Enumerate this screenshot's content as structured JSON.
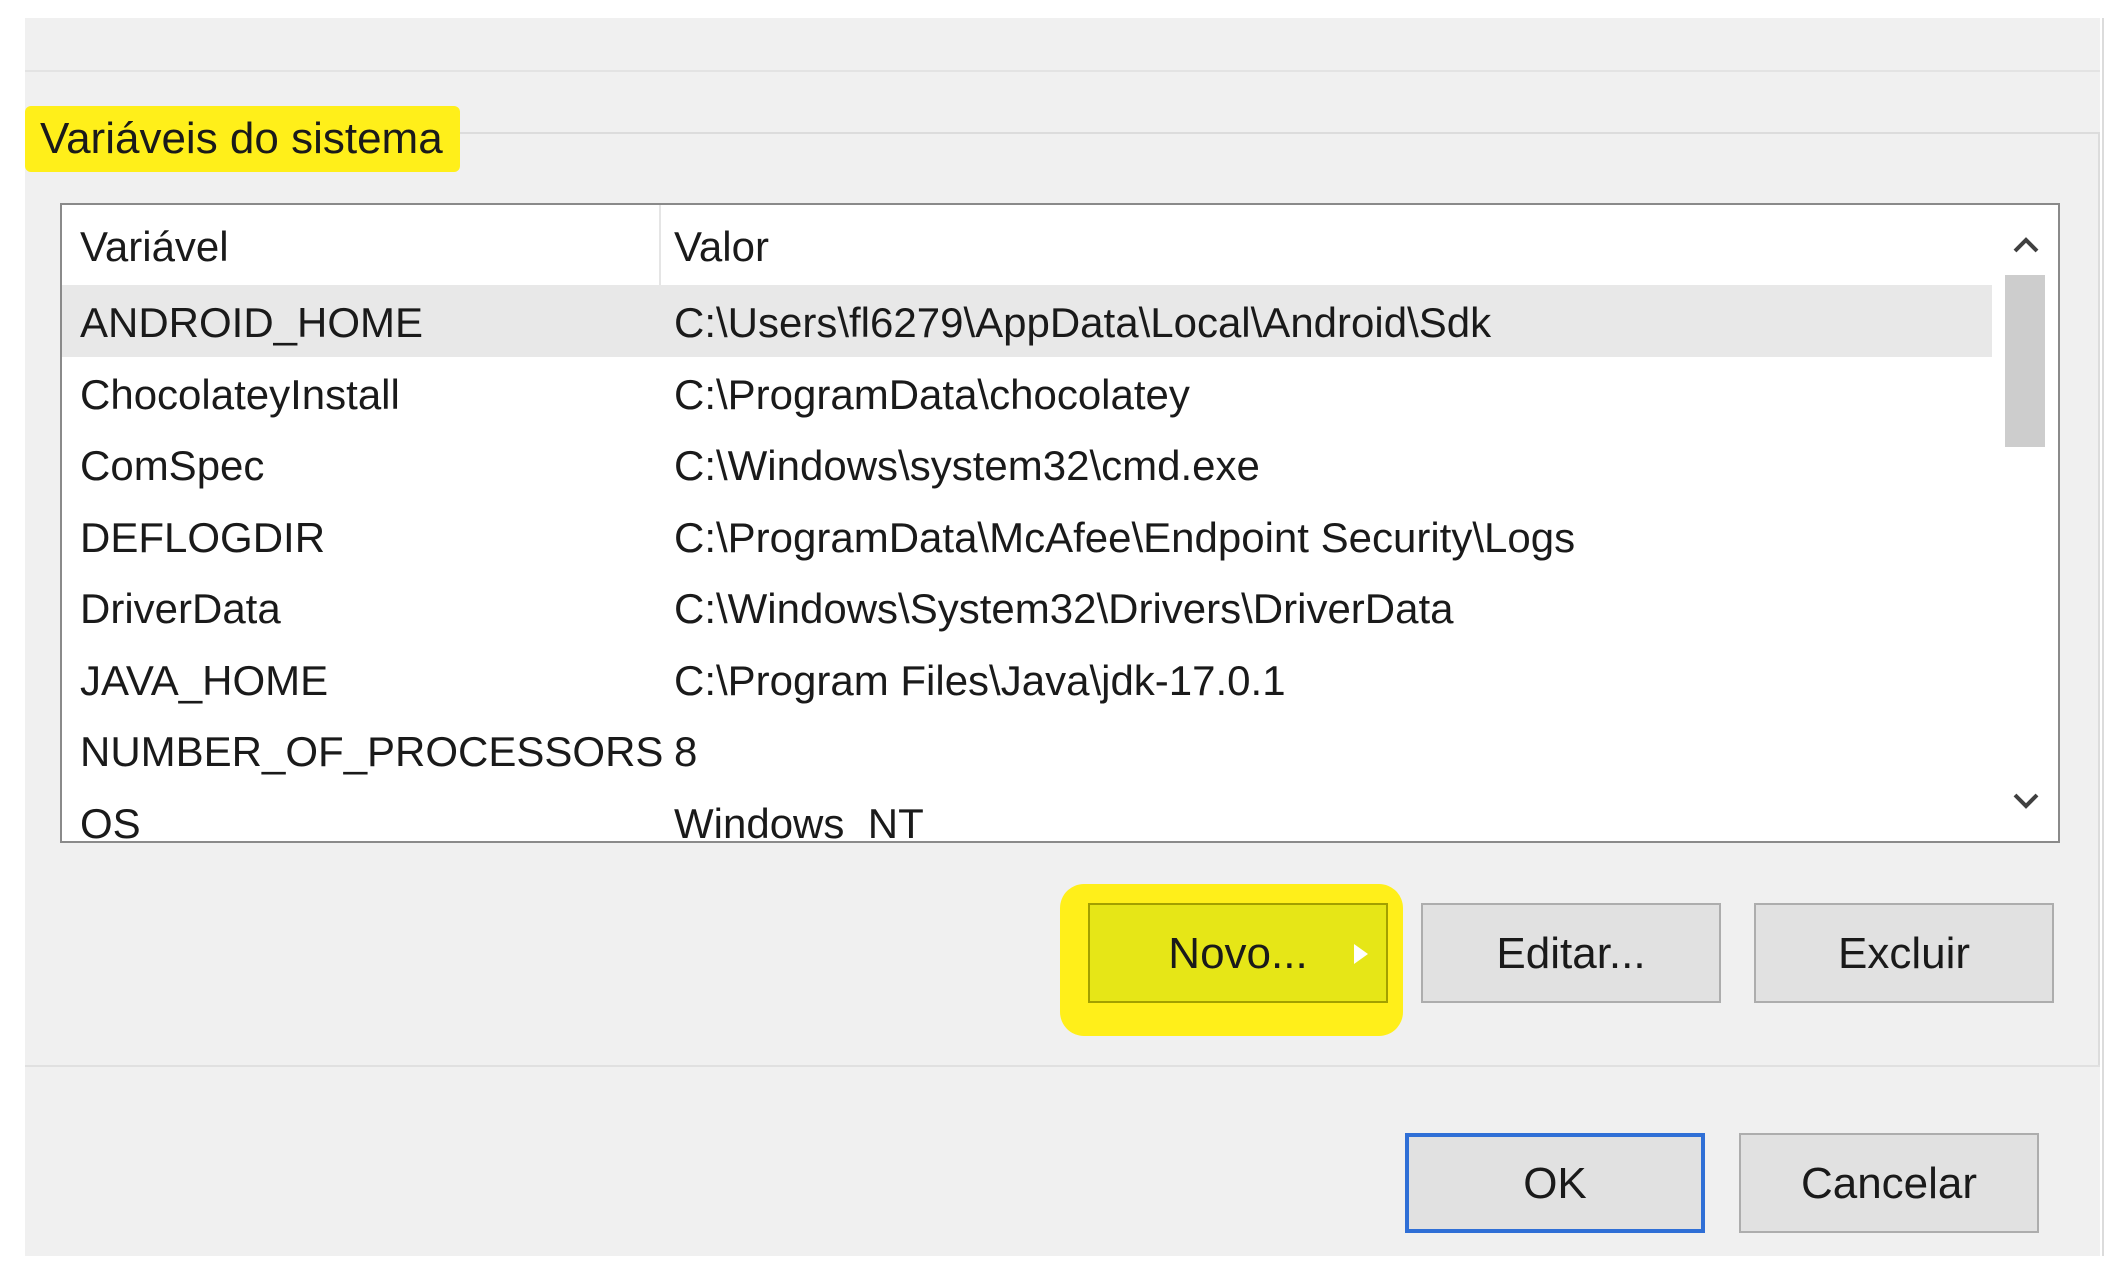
{
  "group": {
    "title": "Variáveis do sistema"
  },
  "table": {
    "headers": {
      "variable": "Variável",
      "value": "Valor"
    },
    "rows": [
      {
        "variable": "ANDROID_HOME",
        "value": "C:\\Users\\fl6279\\AppData\\Local\\Android\\Sdk",
        "selected": true
      },
      {
        "variable": "ChocolateyInstall",
        "value": "C:\\ProgramData\\chocolatey",
        "selected": false
      },
      {
        "variable": "ComSpec",
        "value": "C:\\Windows\\system32\\cmd.exe",
        "selected": false
      },
      {
        "variable": "DEFLOGDIR",
        "value": "C:\\ProgramData\\McAfee\\Endpoint Security\\Logs",
        "selected": false
      },
      {
        "variable": "DriverData",
        "value": "C:\\Windows\\System32\\Drivers\\DriverData",
        "selected": false
      },
      {
        "variable": "JAVA_HOME",
        "value": "C:\\Program Files\\Java\\jdk-17.0.1",
        "selected": false
      },
      {
        "variable": "NUMBER_OF_PROCESSORS",
        "value": "8",
        "selected": false
      },
      {
        "variable": "OS",
        "value": "Windows_NT",
        "selected": false
      }
    ]
  },
  "scrollbar": {
    "up_icon": "chevron-up-icon",
    "down_icon": "chevron-down-icon"
  },
  "actions": {
    "new_label": "Novo...",
    "edit_label": "Editar...",
    "delete_label": "Excluir"
  },
  "footer": {
    "ok_label": "OK",
    "cancel_label": "Cancelar"
  },
  "colors": {
    "highlight": "#ffef1a",
    "selected_row": "#e8e8e8",
    "default_button_border": "#2f6fd6"
  }
}
